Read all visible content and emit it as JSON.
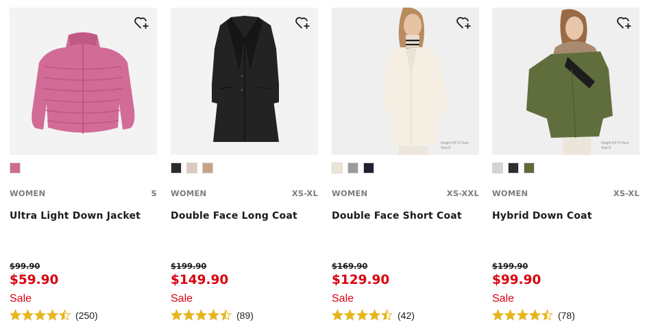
{
  "colors": {
    "price_red": "#d8000f",
    "star_gold": "#e5b51b",
    "image_bg": "#f3f3f3"
  },
  "products": [
    {
      "image_alt": "Pink quilted down jacket",
      "height_note": "",
      "swatches": [
        "#d06a93"
      ],
      "gender": "WOMEN",
      "sizes": "S",
      "name": "Ultra Light Down Jacket",
      "old_price": "$99.90",
      "price": "$59.90",
      "sale": "Sale",
      "rating": 4.5,
      "review_count": "(250)"
    },
    {
      "image_alt": "Black long coat",
      "height_note": "",
      "swatches": [
        "#2b2b2b",
        "#d9cbc1",
        "#c7a385"
      ],
      "gender": "WOMEN",
      "sizes": "XS-XL",
      "name": "Double Face Long Coat",
      "old_price": "$199.90",
      "price": "$149.90",
      "sale": "Sale",
      "rating": 4.5,
      "review_count": "(89)"
    },
    {
      "image_alt": "Model in cream short coat",
      "height_note": "Height:5'9\"/173cm Size:S",
      "swatches": [
        "#ece4d5",
        "#9b9b9b",
        "#1e2230"
      ],
      "gender": "WOMEN",
      "sizes": "XS-XXL",
      "name": "Double Face Short Coat",
      "old_price": "$169.90",
      "price": "$129.90",
      "sale": "Sale",
      "rating": 4.5,
      "review_count": "(42)"
    },
    {
      "image_alt": "Model in olive hybrid down coat",
      "height_note": "Height:5'9\"/174cm Size:S",
      "swatches": [
        "#d4d4d4",
        "#2c2f33",
        "#5d6b3a"
      ],
      "gender": "WOMEN",
      "sizes": "XS-XL",
      "name": "Hybrid Down Coat",
      "old_price": "$199.90",
      "price": "$99.90",
      "sale": "Sale",
      "rating": 4.5,
      "review_count": "(78)"
    }
  ]
}
